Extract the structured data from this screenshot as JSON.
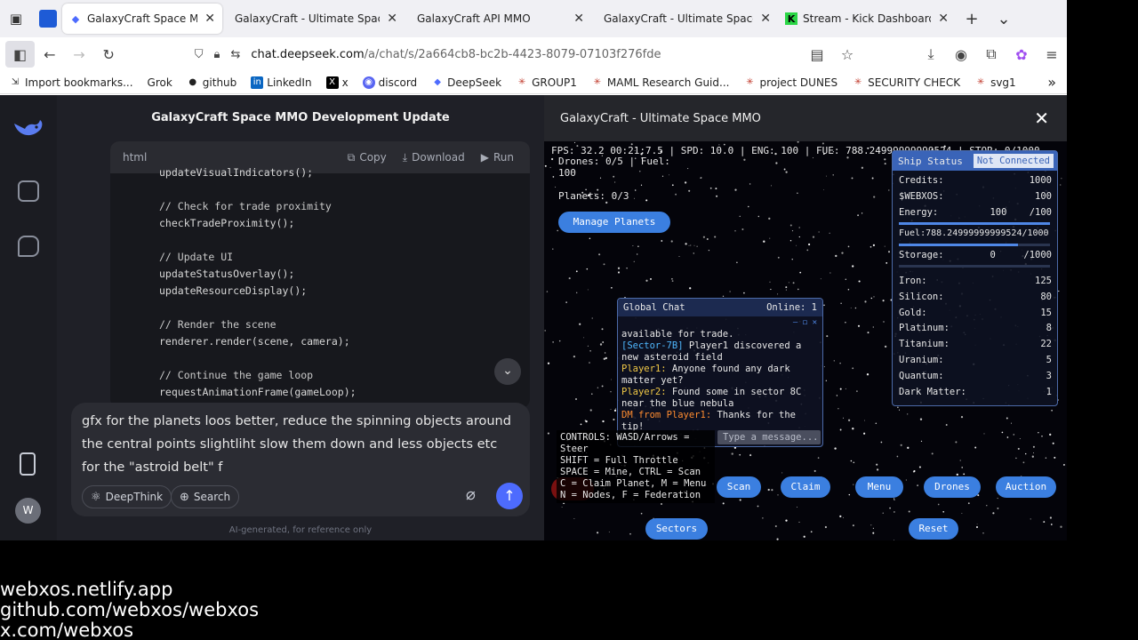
{
  "browser": {
    "tabs": [
      {
        "label": "GalaxyCraft Space MMO De",
        "active": true
      },
      {
        "label": "GalaxyCraft - Ultimate Space M",
        "active": false
      },
      {
        "label": "GalaxyCraft API MMO",
        "active": false
      },
      {
        "label": "GalaxyCraft - Ultimate Space M",
        "active": false
      },
      {
        "label": "Stream - Kick Dashboard",
        "active": false
      }
    ],
    "url_domain": "chat.deepseek.com",
    "url_rest": "/a/chat/s/2a664cb8-bc2b-4423-8079-07103f276fde",
    "bookmarks": [
      "Import bookmarks...",
      "Grok",
      "github",
      "LinkedIn",
      "x",
      "discord",
      "DeepSeek",
      "GROUP1",
      "MAML Research Guid...",
      "project DUNES",
      "SECURITY CHECK",
      "svg1"
    ]
  },
  "chat": {
    "title": "GalaxyCraft Space MMO Development Update",
    "code_lang": "html",
    "copy_label": "Copy",
    "download_label": "Download",
    "run_label": "Run",
    "code_lines": [
      "updateVisualIndicators();",
      "",
      "// Check for trade proximity",
      "checkTradeProximity();",
      "",
      "// Update UI",
      "updateStatusOverlay();",
      "updateResourceDisplay();",
      "",
      "// Render the scene",
      "renderer.render(scene, camera);",
      "",
      "// Continue the game loop",
      "requestAnimationFrame(gameLoop);"
    ],
    "input_text": "gfx for the planets loos better, reduce the spinning objects around the central points slightliht slow them down and less objects etc for the \"astroid belt\" f",
    "deepthink_label": "DeepThink",
    "search_label": "Search",
    "footnote": "AI-generated, for reference only",
    "avatar_initial": "W"
  },
  "game": {
    "title": "GalaxyCraft - Ultimate Space MMO",
    "hud_top": "FPS: 32.2 00:21:7.5 | SPD: 10.0 | ENG: 100 | FUE: 788.24999999999524 | STOR: 0/1000",
    "drones_line1": "Drones: 0/5 | Fuel:",
    "drones_line2": "100",
    "planets": "Planets: 0/3",
    "manage_planets": "Manage Planets",
    "ship_status": {
      "title": "Ship Status",
      "connection": "Not Connected",
      "credits_label": "Credits:",
      "credits": "1000",
      "webxos_label": "$WEBXOS:",
      "webxos": "100",
      "energy_label": "Energy:",
      "energy": "100",
      "energy_max": "/100",
      "energy_level": 1.0,
      "fuel_line": "Fuel:788.24999999999524/1000",
      "fuel_level": 0.79,
      "storage_label": "Storage:",
      "storage": "0",
      "storage_max": "/1000",
      "storage_level": 0.0,
      "resources": [
        {
          "name": "Iron:",
          "value": "125"
        },
        {
          "name": "Silicon:",
          "value": "80"
        },
        {
          "name": "Gold:",
          "value": "15"
        },
        {
          "name": "Platinum:",
          "value": "8"
        },
        {
          "name": "Titanium:",
          "value": "22"
        },
        {
          "name": "Uranium:",
          "value": "5"
        },
        {
          "name": "Quantum:",
          "value": "3"
        },
        {
          "name": "Dark Matter:",
          "value": "1"
        }
      ]
    },
    "global_chat": {
      "title": "Global Chat",
      "online": "Online: 1",
      "partial": "available for trade.",
      "m1_tag": "[Sector-7B]",
      "m1_text": " Player1 discovered a new asteroid field",
      "m2_tag": "Player1:",
      "m2_text": " Anyone found any dark matter yet?",
      "m3_tag": "Player2:",
      "m3_text": " Found some in sector 8C near the blue nebula",
      "m4_tag": "DM from Player1:",
      "m4_text": " Thanks for the tip!",
      "input_placeholder": "Type a message..."
    },
    "controls": [
      "CONTROLS: WASD/Arrows =",
      "Steer",
      "SHIFT = Full Throttle",
      "SPACE = Mine, CTRL = Scan",
      "C = Claim Planet, M = Menu",
      "N = Nodes, F = Federation"
    ],
    "buttons": {
      "scan": "Scan",
      "claim": "Claim",
      "menu": "Menu",
      "drones": "Drones",
      "auction": "Auction",
      "sectors": "Sectors",
      "reset": "Reset"
    }
  },
  "overlay": [
    "webxos.netlify.app",
    "github.com/webxos/webxos",
    "x.com/webxos"
  ]
}
